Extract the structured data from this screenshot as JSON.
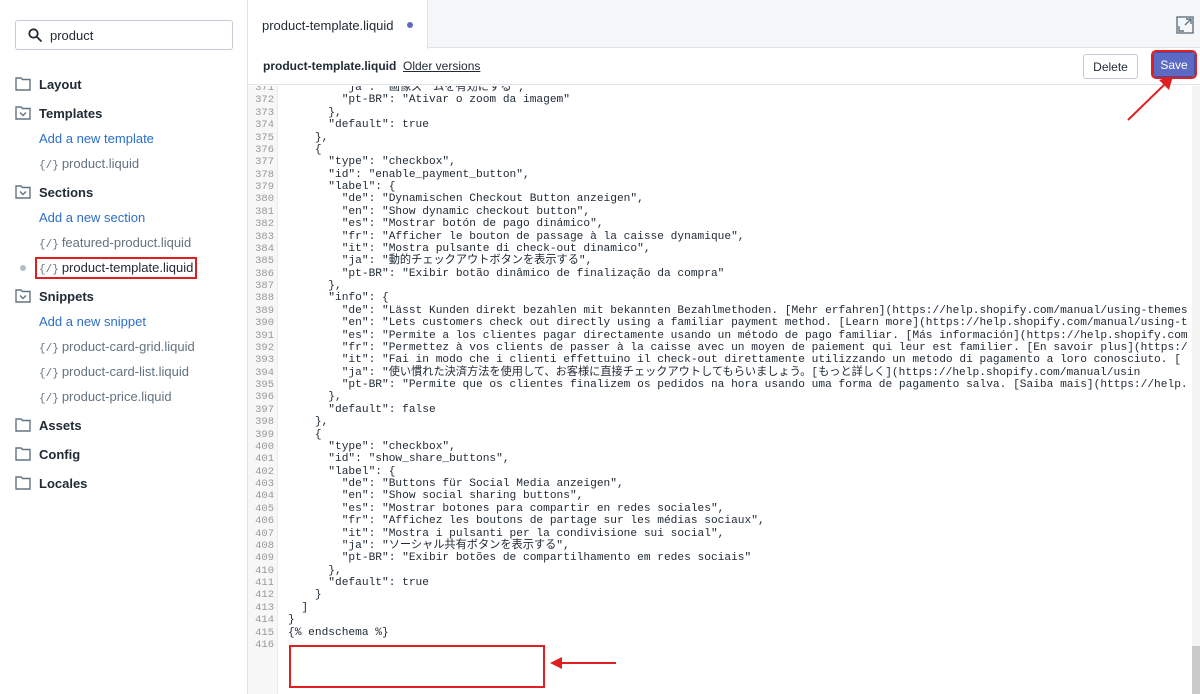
{
  "search": {
    "value": "product"
  },
  "sidebar": {
    "layout": "Layout",
    "templates": "Templates",
    "add_template": "Add a new template",
    "product_liquid": "product.liquid",
    "sections": "Sections",
    "add_section": "Add a new section",
    "featured_product": "featured-product.liquid",
    "product_template": "product-template.liquid",
    "snippets": "Snippets",
    "add_snippet": "Add a new snippet",
    "card_grid": "product-card-grid.liquid",
    "card_list": "product-card-list.liquid",
    "product_price": "product-price.liquid",
    "assets": "Assets",
    "config": "Config",
    "locales": "Locales",
    "file_tag": "{/}"
  },
  "tab": {
    "label": "product-template.liquid"
  },
  "file": {
    "title": "product-template.liquid",
    "older_versions": "Older versions"
  },
  "actions": {
    "delete": "Delete",
    "save": "Save"
  },
  "editor": {
    "line_numbers": [
      "371",
      "372",
      "373",
      "374",
      "375",
      "376",
      "377",
      "378",
      "379",
      "380",
      "381",
      "382",
      "383",
      "384",
      "385",
      "386",
      "387",
      "388",
      "389",
      "390",
      "391",
      "392",
      "393",
      "394",
      "395",
      "396",
      "397",
      "398",
      "399",
      "400",
      "401",
      "402",
      "403",
      "404",
      "405",
      "406",
      "407",
      "408",
      "409",
      "410",
      "411",
      "412",
      "413",
      "414",
      "415",
      "416"
    ],
    "lines": [
      "        \"ja\": \"画像ズームを有効にする\",",
      "        \"pt-BR\": \"Ativar o zoom da imagem\"",
      "      },",
      "      \"default\": true",
      "    },",
      "    {",
      "      \"type\": \"checkbox\",",
      "      \"id\": \"enable_payment_button\",",
      "      \"label\": {",
      "        \"de\": \"Dynamischen Checkout Button anzeigen\",",
      "        \"en\": \"Show dynamic checkout button\",",
      "        \"es\": \"Mostrar botón de pago dinámico\",",
      "        \"fr\": \"Afficher le bouton de passage à la caisse dynamique\",",
      "        \"it\": \"Mostra pulsante di check-out dinamico\",",
      "        \"ja\": \"動的チェックアウトボタンを表示する\",",
      "        \"pt-BR\": \"Exibir botão dinâmico de finalização da compra\"",
      "      },",
      "      \"info\": {",
      "        \"de\": \"Lässt Kunden direkt bezahlen mit bekannten Bezahlmethoden. [Mehr erfahren](https://help.shopify.com/manual/using-themes",
      "        \"en\": \"Lets customers check out directly using a familiar payment method. [Learn more](https://help.shopify.com/manual/using-t",
      "        \"es\": \"Permite a los clientes pagar directamente usando un método de pago familiar. [Más información](https://help.shopify.com",
      "        \"fr\": \"Permettez à vos clients de passer à la caisse avec un moyen de paiement qui leur est familier. [En savoir plus](https:/",
      "        \"it\": \"Fai in modo che i clienti effettuino il check-out direttamente utilizzando un metodo di pagamento a loro conosciuto. [",
      "        \"ja\": \"使い慣れた決済方法を使用して、お客様に直接チェックアウトしてもらいましょう。[もっと詳しく](https://help.shopify.com/manual/usin",
      "        \"pt-BR\": \"Permite que os clientes finalizem os pedidos na hora usando uma forma de pagamento salva. [Saiba mais](https://help.",
      "      },",
      "      \"default\": false",
      "    },",
      "    {",
      "      \"type\": \"checkbox\",",
      "      \"id\": \"show_share_buttons\",",
      "      \"label\": {",
      "        \"de\": \"Buttons für Social Media anzeigen\",",
      "        \"en\": \"Show social sharing buttons\",",
      "        \"es\": \"Mostrar botones para compartir en redes sociales\",",
      "        \"fr\": \"Affichez les boutons de partage sur les médias sociaux\",",
      "        \"it\": \"Mostra i pulsanti per la condivisione sui social\",",
      "        \"ja\": \"ソーシャル共有ボタンを表示する\",",
      "        \"pt-BR\": \"Exibir botões de compartilhamento em redes sociais\"",
      "      },",
      "      \"default\": true",
      "    }",
      "  ]",
      "}",
      "{% endschema %}",
      ""
    ]
  },
  "colors": {
    "accent": "#5c6ac4",
    "annotation": "#e02020",
    "link": "#2c6ecb"
  }
}
